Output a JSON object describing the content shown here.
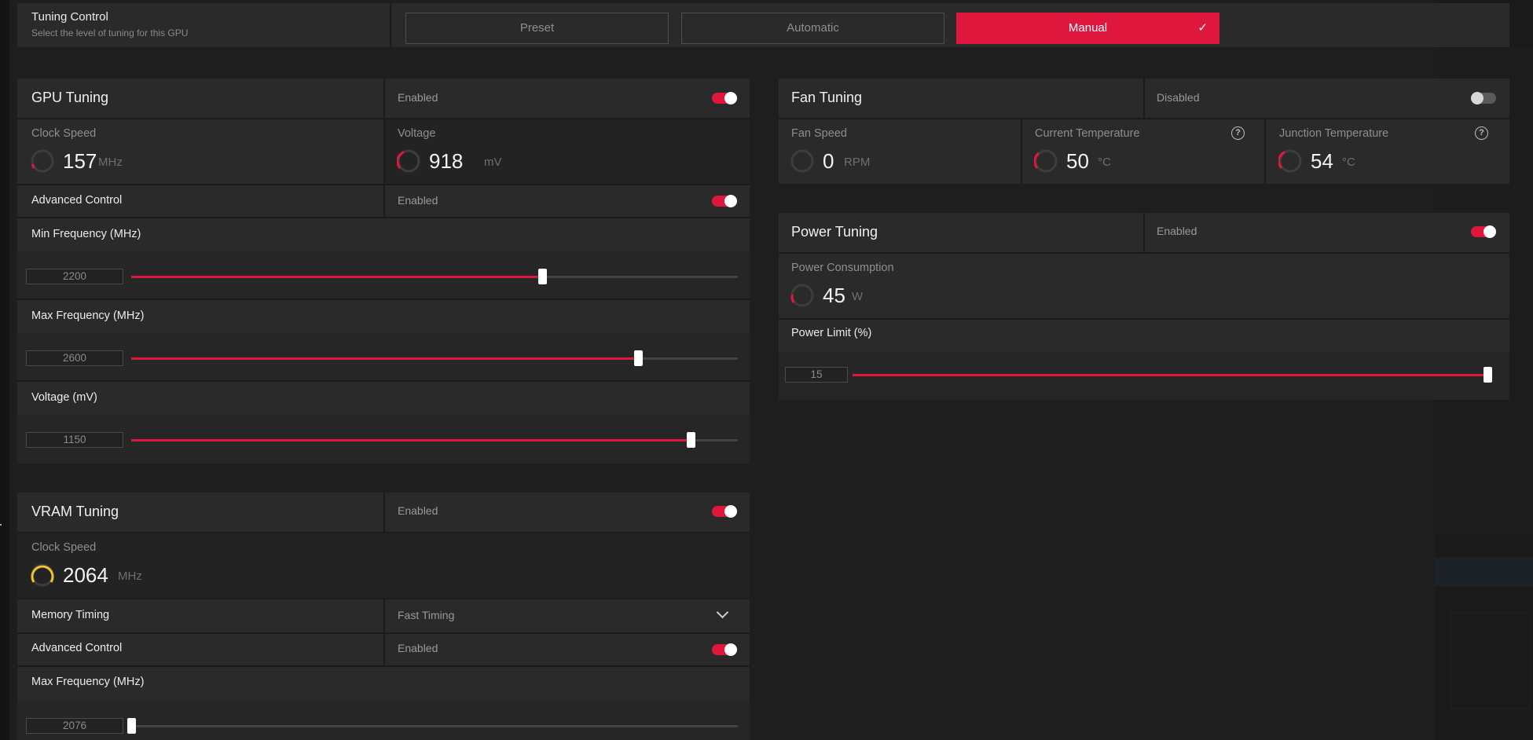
{
  "tuning_control": {
    "title": "Tuning Control",
    "subtitle": "Select the level of tuning for this GPU",
    "options": [
      {
        "label": "Preset",
        "active": false
      },
      {
        "label": "Automatic",
        "active": false
      },
      {
        "label": "Manual",
        "active": true
      }
    ],
    "check_icon": "check-icon"
  },
  "gpu_tuning": {
    "title": "GPU Tuning",
    "state": "Enabled",
    "enabled": true,
    "clock": {
      "label": "Clock Speed",
      "value": "157",
      "unit": "MHz"
    },
    "voltage": {
      "label": "Voltage",
      "value": "918",
      "unit": "mV"
    },
    "advanced": {
      "label": "Advanced Control",
      "state": "Enabled",
      "enabled": true
    },
    "sliders": [
      {
        "label": "Min Frequency (MHz)",
        "value": "2200",
        "level": 0.677
      },
      {
        "label": "Max Frequency (MHz)",
        "value": "2600",
        "level": 0.835
      },
      {
        "label": "Voltage (mV)",
        "value": "1150",
        "level": 0.922
      }
    ]
  },
  "vram_tuning": {
    "title": "VRAM Tuning",
    "state": "Enabled",
    "enabled": true,
    "clock": {
      "label": "Clock Speed",
      "value": "2064",
      "unit": "MHz"
    },
    "memory_timing": {
      "label": "Memory Timing",
      "value": "Fast Timing"
    },
    "advanced": {
      "label": "Advanced Control",
      "state": "Enabled",
      "enabled": true
    },
    "max_freq": {
      "label": "Max Frequency (MHz)",
      "value": "2076",
      "level": 0.0
    }
  },
  "fan_tuning": {
    "title": "Fan Tuning",
    "state": "Disabled",
    "enabled": false,
    "fan_speed": {
      "label": "Fan Speed",
      "value": "0",
      "unit": "RPM"
    },
    "current_temp": {
      "label": "Current Temperature",
      "value": "50",
      "unit": "°C"
    },
    "junction_temp": {
      "label": "Junction Temperature",
      "value": "54",
      "unit": "°C"
    },
    "help_glyph": "?"
  },
  "power_tuning": {
    "title": "Power Tuning",
    "state": "Enabled",
    "enabled": true,
    "consumption": {
      "label": "Power Consumption",
      "value": "45",
      "unit": "W"
    },
    "limit": {
      "label": "Power Limit (%)",
      "value": "15",
      "level": 1.0
    }
  },
  "colors": {
    "accent": "#e0173c",
    "gauge_yellow": "#f2c12e",
    "background": "#1e1e1f"
  }
}
